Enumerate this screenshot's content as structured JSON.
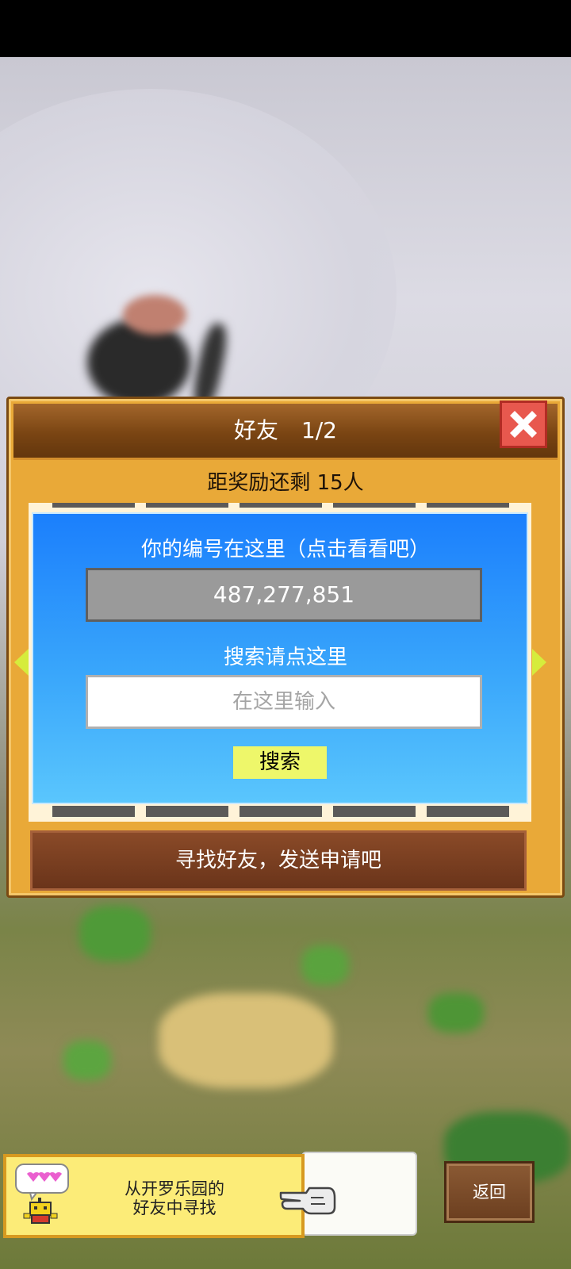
{
  "dialog": {
    "title": "好友",
    "page": "1/2",
    "reward_text": "距奖励还剩 15人",
    "id_label": "你的编号在这里（点击看看吧）",
    "id_value": "487,277,851",
    "search_label": "搜索请点这里",
    "search_placeholder": "在这里输入",
    "search_button": "搜索",
    "find_friends_button": "寻找好友，发送申请吧"
  },
  "bottom": {
    "banner_line1": "从开罗乐园的",
    "banner_line2": "好友中寻找",
    "back_button": "返回"
  },
  "icons": {
    "close": "close-icon",
    "left_arrow": "arrow-left-icon",
    "right_arrow": "arrow-right-icon",
    "robot": "robot-icon",
    "hand": "pointing-hand-icon",
    "hearts": "hearts-icon"
  },
  "colors": {
    "dialog_bg": "#e9a938",
    "header": "#7a4513",
    "panel_top": "#1b7ffc",
    "panel_bottom": "#5ac6fd",
    "search_button": "#eef76a",
    "close_button": "#e8584e"
  }
}
